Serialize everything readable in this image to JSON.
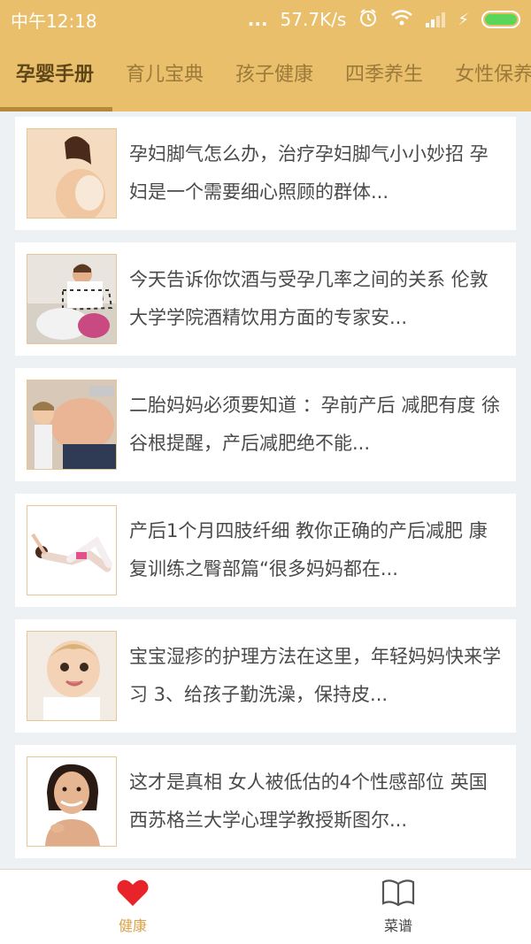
{
  "status_bar": {
    "time": "中午12:18",
    "dots": "...",
    "speed": "57.7K/s",
    "battery_color": "#5bd65b"
  },
  "tabs": [
    {
      "label": "孕婴手册",
      "active": true
    },
    {
      "label": "育儿宝典"
    },
    {
      "label": "孩子健康"
    },
    {
      "label": "四季养生"
    },
    {
      "label": "女性保养"
    }
  ],
  "articles": [
    {
      "text": "孕妇脚气怎么办，治疗孕妇脚气小小妙招 孕妇是一个需要细心照顾的群体...",
      "icon": "pregnant-woman-image"
    },
    {
      "text": "今天告诉你饮酒与受孕几率之间的关系 伦敦大学学院酒精饮用方面的专家安...",
      "icon": "couple-image"
    },
    {
      "text": "二胎妈妈必须要知道 ：孕前产后 减肥有度 徐谷根提醒，产后减肥绝不能...",
      "icon": "child-belly-image"
    },
    {
      "text": "产后1个月四肢纤细 教你正确的产后减肥 康复训练之臀部篇“很多妈妈都在...",
      "icon": "exercise-image"
    },
    {
      "text": "宝宝湿疹的护理方法在这里，年轻妈妈快来学习 3、给孩子勤洗澡，保持皮...",
      "icon": "baby-image"
    },
    {
      "text": "这才是真相 女人被低估的4个性感部位 英国西苏格兰大学心理学教授斯图尔...",
      "icon": "woman-portrait-image"
    }
  ],
  "bottom_nav": [
    {
      "label": "健康",
      "icon": "heart-icon",
      "active": true,
      "color": "#d9a24a"
    },
    {
      "label": "菜谱",
      "icon": "book-icon"
    }
  ],
  "colors": {
    "header": "#e9bf6c",
    "active_tab_text": "#5e4617",
    "inactive_tab_text": "#9b7a3a",
    "heart": "#e8232a"
  }
}
